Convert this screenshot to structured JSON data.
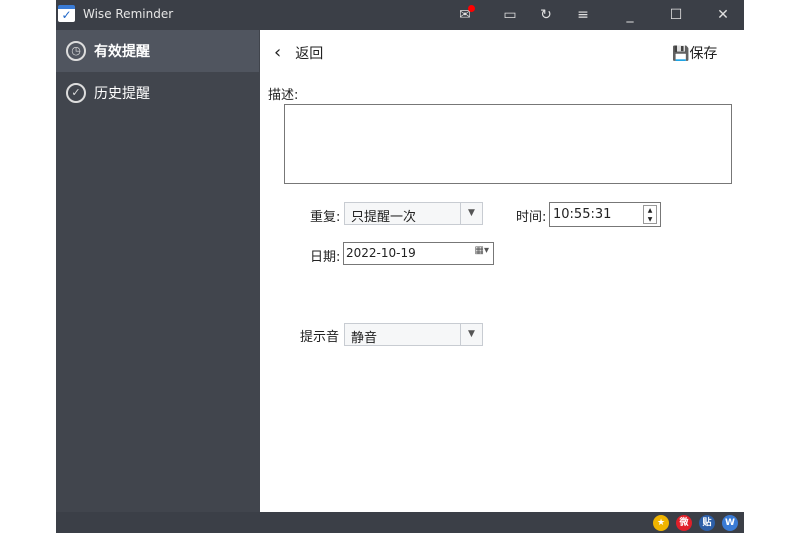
{
  "app": {
    "title": "Wise Reminder"
  },
  "sidebar": {
    "items": [
      {
        "label": "有效提醒"
      },
      {
        "label": "历史提醒"
      }
    ]
  },
  "header": {
    "back_label": "返回",
    "save_label": "保存"
  },
  "form": {
    "description_label": "描述:",
    "description_value": "",
    "repeat_label": "重复:",
    "repeat_value": "只提醒一次",
    "time_label": "时间:",
    "time_value": "10:55:31",
    "date_label": "日期:",
    "date_value": "2022-10-19",
    "sound_label": "提示音",
    "sound_value": "静音"
  },
  "colors": {
    "titlebar": "#3b3f47",
    "sidebar": "#41454d",
    "active": "#50555f",
    "notify": "#ff0000"
  }
}
